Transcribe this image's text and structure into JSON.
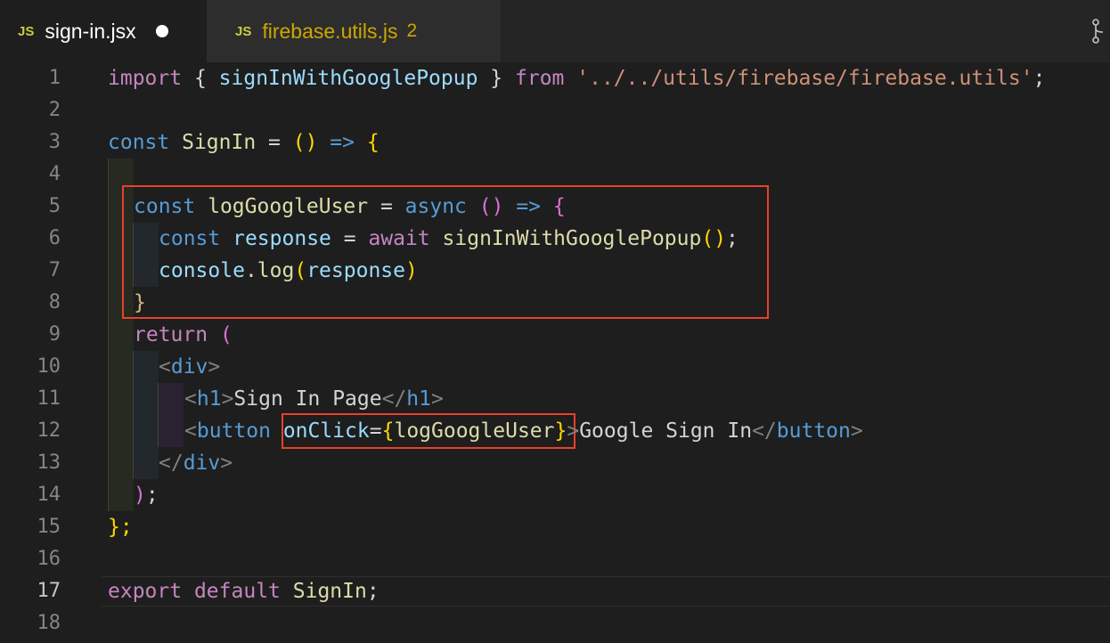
{
  "tabs": [
    {
      "badge": "JS",
      "title": "sign-in.jsx",
      "dirty": true
    },
    {
      "badge": "JS",
      "title": "firebase.utils.js",
      "count": "2"
    }
  ],
  "line_numbers": [
    "1",
    "2",
    "3",
    "4",
    "5",
    "6",
    "7",
    "8",
    "9",
    "10",
    "11",
    "12",
    "13",
    "14",
    "15",
    "16",
    "17",
    "18"
  ],
  "code": {
    "l1": {
      "import": "import",
      "open": "{ ",
      "name": "signInWithGooglePopup",
      "close": " } ",
      "from": "from",
      "path": "'../../utils/firebase/firebase.utils'",
      "semi": ";"
    },
    "l3": {
      "const": "const",
      "name": "SignIn",
      "eq": " = ",
      "paren": "()",
      "arrow": " => ",
      "brace": "{"
    },
    "l5": {
      "const": "const",
      "name": "logGoogleUser",
      "eq": " = ",
      "async": "async",
      "paren": " ()",
      "arrow": " => ",
      "brace": "{"
    },
    "l6": {
      "const": "const",
      "name": "response",
      "eq": " = ",
      "await": "await",
      "call": "signInWithGooglePopup",
      "paren": "()",
      "semi": ";"
    },
    "l7": {
      "obj": "console",
      "dot": ".",
      "method": "log",
      "open": "(",
      "arg": "response",
      "close": ")"
    },
    "l8": {
      "brace": "}"
    },
    "l9": {
      "ret": "return",
      "paren": " ("
    },
    "l10": {
      "lt": "<",
      "tag": "div",
      "gt": ">"
    },
    "l11": {
      "lt": "<",
      "tag": "h1",
      "gt": ">",
      "text": "Sign In Page",
      "lt2": "</",
      "tag2": "h1",
      "gt2": ">"
    },
    "l12": {
      "lt": "<",
      "tag": "button",
      "attr": "onClick",
      "eq": "=",
      "open": "{",
      "val": "logGoogleUser",
      "close": "}",
      "gt": ">",
      "text": "Google Sign In",
      "lt2": "</",
      "tag2": "button",
      "gt2": ">"
    },
    "l13": {
      "lt": "</",
      "tag": "div",
      "gt": ">"
    },
    "l14": {
      "paren": ")",
      "semi": ";"
    },
    "l15": {
      "text": "};"
    },
    "l17": {
      "export": "export",
      "default": "default",
      "name": "SignIn",
      "semi": ";"
    }
  },
  "current_line": "17",
  "colors": {
    "highlight_box": "#e8412c",
    "background": "#1e1e1e",
    "keyword": "#569cd6",
    "control_keyword": "#c586c0",
    "function": "#dcdcaa",
    "variable": "#9cdcfe",
    "string": "#ce9178",
    "bracket": "#ffd700"
  },
  "icons": {
    "js_badge": "js-file-icon",
    "git": "git-compare-icon"
  }
}
